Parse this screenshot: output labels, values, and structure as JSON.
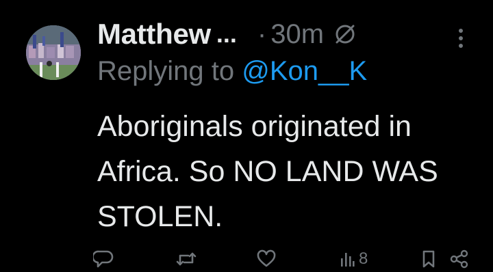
{
  "tweet": {
    "author_name": "Matthew",
    "truncation": "...",
    "separator": "·",
    "time": "30m",
    "reply_prefix": "Replying to",
    "reply_handle": "@Kon__K",
    "text": "Aboriginals originated in Africa. So NO LAND WAS STOLEN."
  },
  "actions": {
    "views_count": "8"
  },
  "icons": {
    "edit": "edited-slash-circle-icon",
    "more": "more-vertical-icon",
    "reply": "reply-bubble-icon",
    "retweet": "retweet-icon",
    "like": "heart-icon",
    "views": "bar-chart-icon",
    "bookmark": "bookmark-icon",
    "share": "share-icon"
  },
  "colors": {
    "background": "#000000",
    "primary_text": "#e7e9ea",
    "secondary_text": "#71767b",
    "link": "#1d9bf0"
  }
}
